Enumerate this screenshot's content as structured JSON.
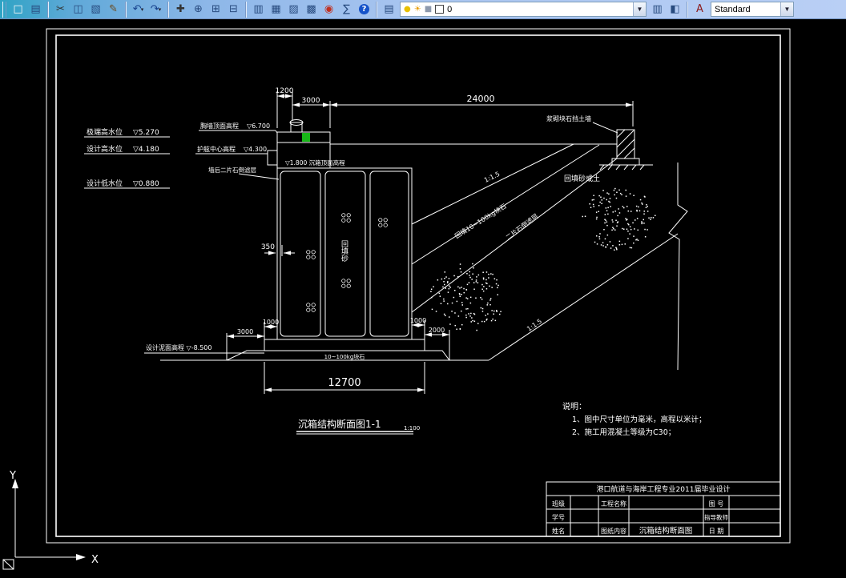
{
  "toolbar": {
    "items": [
      {
        "type": "grip"
      },
      {
        "type": "button",
        "name": "new-button",
        "glyph": "□",
        "color": "#f8f8f8"
      },
      {
        "type": "button",
        "name": "plot-button",
        "glyph": "▤",
        "color": "#274a7e"
      },
      {
        "type": "sep"
      },
      {
        "type": "button",
        "name": "cut-button",
        "glyph": "✂",
        "color": "#333333"
      },
      {
        "type": "button",
        "name": "copy-button",
        "glyph": "◫",
        "color": "#274a7e"
      },
      {
        "type": "button",
        "name": "paste-button",
        "glyph": "▧",
        "color": "#274a7e"
      },
      {
        "type": "button",
        "name": "match-properties-button",
        "glyph": "✎",
        "color": "#6b4a1e"
      },
      {
        "type": "sep"
      },
      {
        "type": "button",
        "name": "undo-button",
        "glyph": "↶",
        "color": "#16418c",
        "dropdown": true
      },
      {
        "type": "button",
        "name": "redo-button",
        "glyph": "↷",
        "color": "#16418c",
        "dropdown": true
      },
      {
        "type": "sep"
      },
      {
        "type": "button",
        "name": "pan-button",
        "glyph": "✚",
        "color": "#333333"
      },
      {
        "type": "button",
        "name": "zoom-realtime-button",
        "glyph": "⊕",
        "color": "#274a7e"
      },
      {
        "type": "button",
        "name": "zoom-window-button",
        "glyph": "⊞",
        "color": "#274a7e"
      },
      {
        "type": "button",
        "name": "zoom-previous-button",
        "glyph": "⊟",
        "color": "#274a7e"
      },
      {
        "type": "sep"
      },
      {
        "type": "button",
        "name": "properties-button",
        "glyph": "▥",
        "color": "#274a7e"
      },
      {
        "type": "button",
        "name": "designcenter-button",
        "glyph": "▦",
        "color": "#274a7e"
      },
      {
        "type": "button",
        "name": "tool-palettes-button",
        "glyph": "▨",
        "color": "#274a7e"
      },
      {
        "type": "button",
        "name": "sheet-set-manager-button",
        "glyph": "▩",
        "color": "#274a7e"
      },
      {
        "type": "button",
        "name": "markup-button",
        "glyph": "◉",
        "color": "#c03020"
      },
      {
        "type": "button",
        "name": "quickcalc-button",
        "glyph": "∑",
        "color": "#274a7e"
      },
      {
        "type": "button",
        "name": "help-button",
        "glyph": "?",
        "color": "#ffffff",
        "badge": "help"
      },
      {
        "type": "sep"
      },
      {
        "type": "button",
        "name": "layers-button",
        "glyph": "▤",
        "color": "#274a7e"
      },
      {
        "type": "layer-combo"
      },
      {
        "type": "button",
        "name": "layer-properties-button",
        "glyph": "▥",
        "color": "#274a7e"
      },
      {
        "type": "button",
        "name": "layer-previous-button",
        "glyph": "◧",
        "color": "#274a7e"
      },
      {
        "type": "sep"
      },
      {
        "type": "button",
        "name": "text-style-button",
        "glyph": "A",
        "color": "#8b1a1a"
      },
      {
        "type": "style-combo"
      }
    ],
    "layer_combo": {
      "value": "0",
      "icons": [
        {
          "name": "layer-on-bulb-icon",
          "glyph": "●",
          "color": "#e8c000"
        },
        {
          "name": "layer-thaw-sun-icon",
          "glyph": "☀",
          "color": "#e89b00"
        },
        {
          "name": "layer-lock-icon",
          "glyph": "■",
          "color": "#8d99ad"
        }
      ]
    },
    "style_combo": {
      "value": "Standard"
    }
  },
  "drawing": {
    "dims": {
      "top_1200": "1200",
      "top_3000": "3000",
      "top_24000": "24000",
      "wall_350": "350",
      "left_1000": "1000",
      "left_3000": "3000",
      "right_1000": "1000",
      "right_2000": "2000",
      "base_12700": "12700"
    },
    "levels": [
      {
        "label": "极端高水位",
        "value": "▽5.270"
      },
      {
        "label": "设计高水位",
        "value": "▽4.180"
      },
      {
        "label": "设计低水位",
        "value": "▽0.880"
      }
    ],
    "elev": {
      "cope_label": "胸墙顶面高程",
      "cope_value": "▽6.700",
      "fender_label": "护舷中心高程",
      "fender_value": "▽4.300",
      "caisson_top": "▽1.800 沉箱顶面高程",
      "mudline": "设计泥面高程 ▽-8.500"
    },
    "annotations": {
      "filter_layer": "墙后二片石倒滤层",
      "backfill_soil": "回填砂或土",
      "retaining_wall": "浆砌块石挡土墙",
      "slope_1": "1:1.5",
      "rock_fill": "回填10~100kg块石",
      "filter_2": "二片石倒滤层",
      "slope_2": "1:1.5",
      "sand_fill": "回填砂",
      "bedding": "10~100kg块石"
    },
    "title": {
      "text": "沉箱结构断面图1-1",
      "scale": "1:100"
    },
    "notes": {
      "heading": "说明：",
      "items": [
        "1、图中尺寸单位为毫米，高程以米计；",
        "2、施工用混凝土等级为C30；"
      ]
    },
    "title_block": {
      "header": "港口航道与海岸工程专业2011届毕业设计",
      "left_labels": [
        "班级",
        "学号",
        "姓名"
      ],
      "mid_labels": [
        "工程名称",
        "图纸内容"
      ],
      "content": "沉箱结构断面图",
      "right_labels": [
        "图  号",
        "指导教师",
        "日  期"
      ]
    },
    "ucs": {
      "x": "X",
      "y": "Y"
    }
  }
}
